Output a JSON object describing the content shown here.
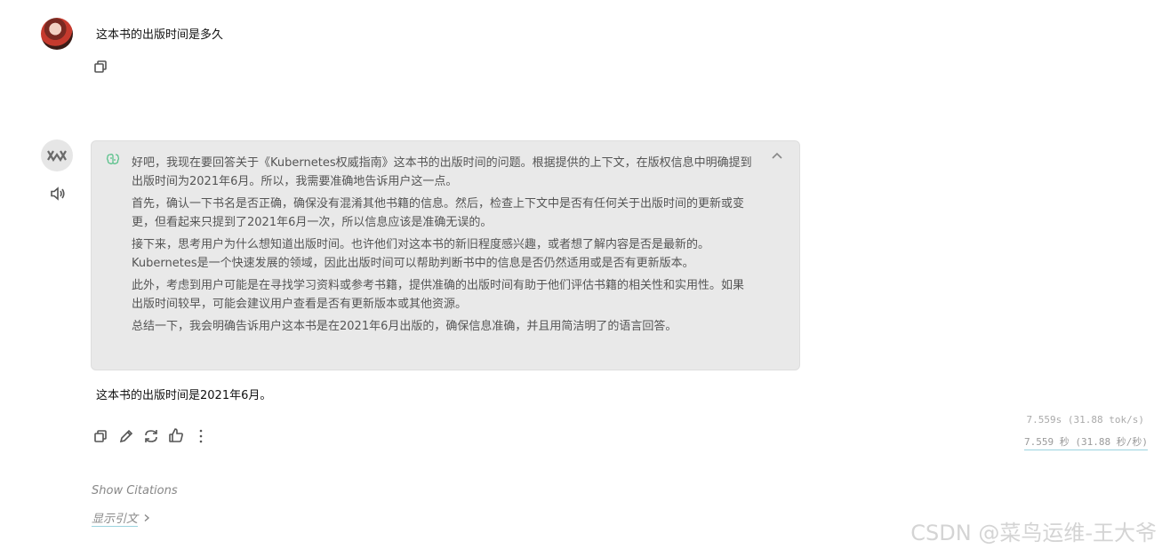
{
  "user_message": "这本书的出版时间是多久",
  "thinking": {
    "paragraphs": [
      "好吧，我现在要回答关于《Kubernetes权威指南》这本书的出版时间的问题。根据提供的上下文，在版权信息中明确提到出版时间为2021年6月。所以，我需要准确地告诉用户这一点。",
      "首先，确认一下书名是否正确，确保没有混淆其他书籍的信息。然后，检查上下文中是否有任何关于出版时间的更新或变更，但看起来只提到了2021年6月一次，所以信息应该是准确无误的。",
      "接下来，思考用户为什么想知道出版时间。也许他们对这本书的新旧程度感兴趣，或者想了解内容是否是最新的。Kubernetes是一个快速发展的领域，因此出版时间可以帮助判断书中的信息是否仍然适用或是否有更新版本。",
      "此外，考虑到用户可能是在寻找学习资料或参考书籍，提供准确的出版时间有助于他们评估书籍的相关性和实用性。如果出版时间较早，可能会建议用户查看是否有更新版本或其他资源。",
      "总结一下，我会明确告诉用户这本书是在2021年6月出版的，确保信息准确，并且用简洁明了的语言回答。"
    ]
  },
  "answer": "这本书的出版时间是2021年6月。",
  "stats": {
    "line1": "7.559s (31.88 tok/s)",
    "line2": "7.559 秒 (31.88 秒/秒)"
  },
  "citations": {
    "show_en": "Show Citations",
    "show_zh": "显示引文"
  },
  "watermark": "CSDN @菜鸟运维-王大爷",
  "icons": {
    "copy": "copy-icon",
    "speaker": "speaker-icon",
    "edit": "edit-icon",
    "regenerate": "regenerate-icon",
    "like": "thumbs-up-icon",
    "more": "more-vertical-icon",
    "brain": "brain-icon",
    "collapse": "chevron-up-icon",
    "chevron": "chevron-right-icon"
  }
}
